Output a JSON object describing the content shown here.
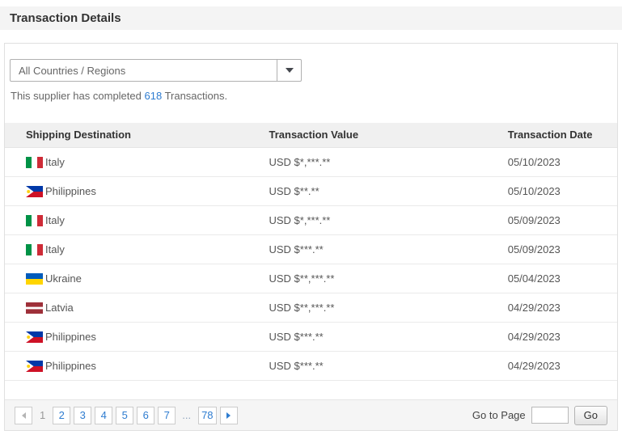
{
  "page": {
    "title": "Transaction Details"
  },
  "filter": {
    "dropdown_value": "All Countries / Regions"
  },
  "summary": {
    "prefix": "This supplier has completed ",
    "count": "618",
    "suffix": " Transactions."
  },
  "table": {
    "headers": [
      "Shipping Destination",
      "Transaction Value",
      "Transaction Date"
    ],
    "rows": [
      {
        "flag": "italy",
        "country": "Italy",
        "value": "USD $*,***.**",
        "date": "05/10/2023"
      },
      {
        "flag": "philippines",
        "country": "Philippines",
        "value": "USD $**.**",
        "date": "05/10/2023"
      },
      {
        "flag": "italy",
        "country": "Italy",
        "value": "USD $*,***.**",
        "date": "05/09/2023"
      },
      {
        "flag": "italy",
        "country": "Italy",
        "value": "USD $***.**",
        "date": "05/09/2023"
      },
      {
        "flag": "ukraine",
        "country": "Ukraine",
        "value": "USD $**,***.**",
        "date": "05/04/2023"
      },
      {
        "flag": "latvia",
        "country": "Latvia",
        "value": "USD $**,***.**",
        "date": "04/29/2023"
      },
      {
        "flag": "philippines",
        "country": "Philippines",
        "value": "USD $***.**",
        "date": "04/29/2023"
      },
      {
        "flag": "philippines",
        "country": "Philippines",
        "value": "USD $***.**",
        "date": "04/29/2023"
      }
    ]
  },
  "pagination": {
    "current": "1",
    "pages": [
      "2",
      "3",
      "4",
      "5",
      "6",
      "7"
    ],
    "ellipsis": "...",
    "last": "78",
    "goto_label": "Go to Page",
    "go_button": "Go"
  },
  "colors": {
    "link_blue": "#2e7cd0",
    "title_bar_bg": "#f4f4f4",
    "table_header_bg": "#f0f0f0",
    "pager_bar_bg": "#f5f5f5"
  }
}
